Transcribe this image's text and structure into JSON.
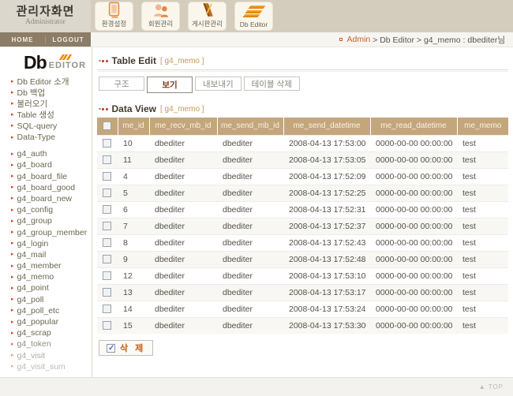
{
  "header": {
    "title": "관리자화면",
    "subtitle": "Administrator",
    "tabs": [
      {
        "label": "환경설정",
        "icon": "monitor-icon"
      },
      {
        "label": "회원관리",
        "icon": "members-icon"
      },
      {
        "label": "게시판관리",
        "icon": "board-icon"
      },
      {
        "label": "Db Editor",
        "icon": "db-stripes-icon"
      }
    ],
    "nav": {
      "home": "HOME",
      "logout": "LOGOUT"
    },
    "breadcrumb": {
      "home": "Admin",
      "rest": " > Db Editor > g4_memo : dbediter님"
    }
  },
  "sidebar": {
    "logo_db": "Db",
    "logo_editor": "EDITOR",
    "menu": [
      "Db Editor 소개",
      "Db 백업",
      "불러오기",
      "Table 생성",
      "SQL-query",
      "Data-Type"
    ],
    "tables": [
      "g4_auth",
      "g4_board",
      "g4_board_file",
      "g4_board_good",
      "g4_board_new",
      "g4_config",
      "g4_group",
      "g4_group_member",
      "g4_login",
      "g4_mail",
      "g4_member",
      "g4_memo",
      "g4_point",
      "g4_poll",
      "g4_poll_etc",
      "g4_popular",
      "g4_scrap",
      "g4_token",
      "g4_visit",
      "g4_visit_sum"
    ]
  },
  "table_edit": {
    "title": "Table Edit",
    "table_ref": "[ g4_memo ]",
    "buttons": [
      "구조",
      "보기",
      "내보내기",
      "테이블 삭제"
    ],
    "active_button": "보기"
  },
  "data_view": {
    "title": "Data View",
    "table_ref": "[ g4_memo ]",
    "columns": [
      "me_id",
      "me_recv_mb_id",
      "me_send_mb_id",
      "me_send_datetime",
      "me_read_datetime",
      "me_memo"
    ],
    "rows": [
      [
        "10",
        "dbediter",
        "dbediter",
        "2008-04-13 17:53:00",
        "0000-00-00 00:00:00",
        "test"
      ],
      [
        "11",
        "dbediter",
        "dbediter",
        "2008-04-13 17:53:05",
        "0000-00-00 00:00:00",
        "test"
      ],
      [
        "4",
        "dbediter",
        "dbediter",
        "2008-04-13 17:52:09",
        "0000-00-00 00:00:00",
        "test"
      ],
      [
        "5",
        "dbediter",
        "dbediter",
        "2008-04-13 17:52:25",
        "0000-00-00 00:00:00",
        "test"
      ],
      [
        "6",
        "dbediter",
        "dbediter",
        "2008-04-13 17:52:31",
        "0000-00-00 00:00:00",
        "test"
      ],
      [
        "7",
        "dbediter",
        "dbediter",
        "2008-04-13 17:52:37",
        "0000-00-00 00:00:00",
        "test"
      ],
      [
        "8",
        "dbediter",
        "dbediter",
        "2008-04-13 17:52:43",
        "0000-00-00 00:00:00",
        "test"
      ],
      [
        "9",
        "dbediter",
        "dbediter",
        "2008-04-13 17:52:48",
        "0000-00-00 00:00:00",
        "test"
      ],
      [
        "12",
        "dbediter",
        "dbediter",
        "2008-04-13 17:53:10",
        "0000-00-00 00:00:00",
        "test"
      ],
      [
        "13",
        "dbediter",
        "dbediter",
        "2008-04-13 17:53:17",
        "0000-00-00 00:00:00",
        "test"
      ],
      [
        "14",
        "dbediter",
        "dbediter",
        "2008-04-13 17:53:24",
        "0000-00-00 00:00:00",
        "test"
      ],
      [
        "15",
        "dbediter",
        "dbediter",
        "2008-04-13 17:53:30",
        "0000-00-00 00:00:00",
        "test"
      ]
    ],
    "delete_label": "삭 제"
  },
  "footer": {
    "top_icon": "▲",
    "top_label": "TOP"
  },
  "icons": {
    "menu_arrow": "▸"
  },
  "colors": {
    "accent_orange": "#cc5f2a",
    "table_header_bg": "#c3a67c",
    "header_bg": "#d4ccbd",
    "nav_bg": "#8b7d67",
    "tab_bg": "#faf6ec"
  }
}
